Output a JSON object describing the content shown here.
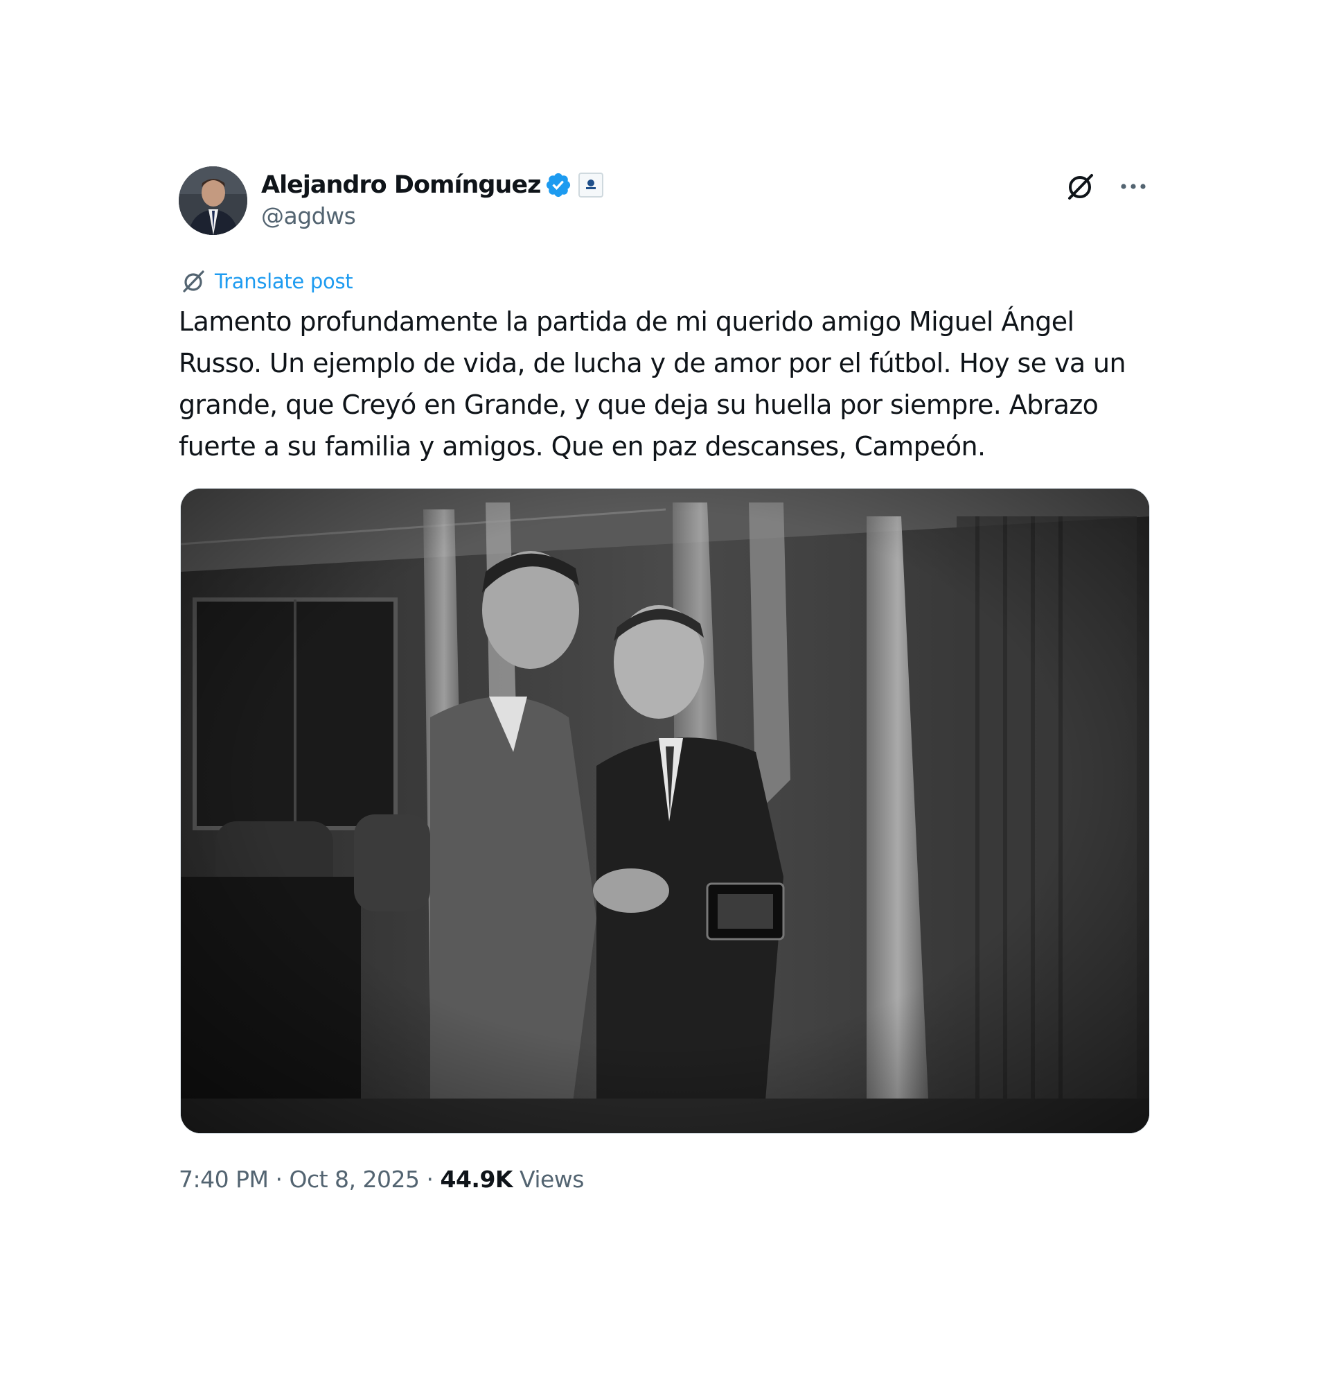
{
  "author": {
    "display_name": "Alejandro Domínguez",
    "handle": "@agdws",
    "verified_color": "#1d9bf0"
  },
  "post": {
    "translate_label": "Translate post",
    "text": "Lamento profundamente la partida de mi querido amigo Miguel Ángel Russo. Un ejemplo de vida, de lucha y de amor por el fútbol. Hoy se va un grande, que Creyó en Grande, y que deja su huella por siempre. Abrazo fuerte a su familia y amigos. Que en paz descanses, Campeón.",
    "media": "black-and-white photo of two men shaking hands"
  },
  "meta": {
    "time": "7:40 PM",
    "separator": "·",
    "date": "Oct 8, 2025",
    "views_count": "44.9K",
    "views_label": "Views"
  },
  "icons": {
    "grok": "grok-icon",
    "more": "more-icon",
    "translate": "globe-icon",
    "verified": "verified-badge-icon",
    "affiliate": "affiliate-badge-icon"
  },
  "colors": {
    "link": "#1d9bf0",
    "secondary_text": "#536471",
    "primary_text": "#0f1419"
  }
}
